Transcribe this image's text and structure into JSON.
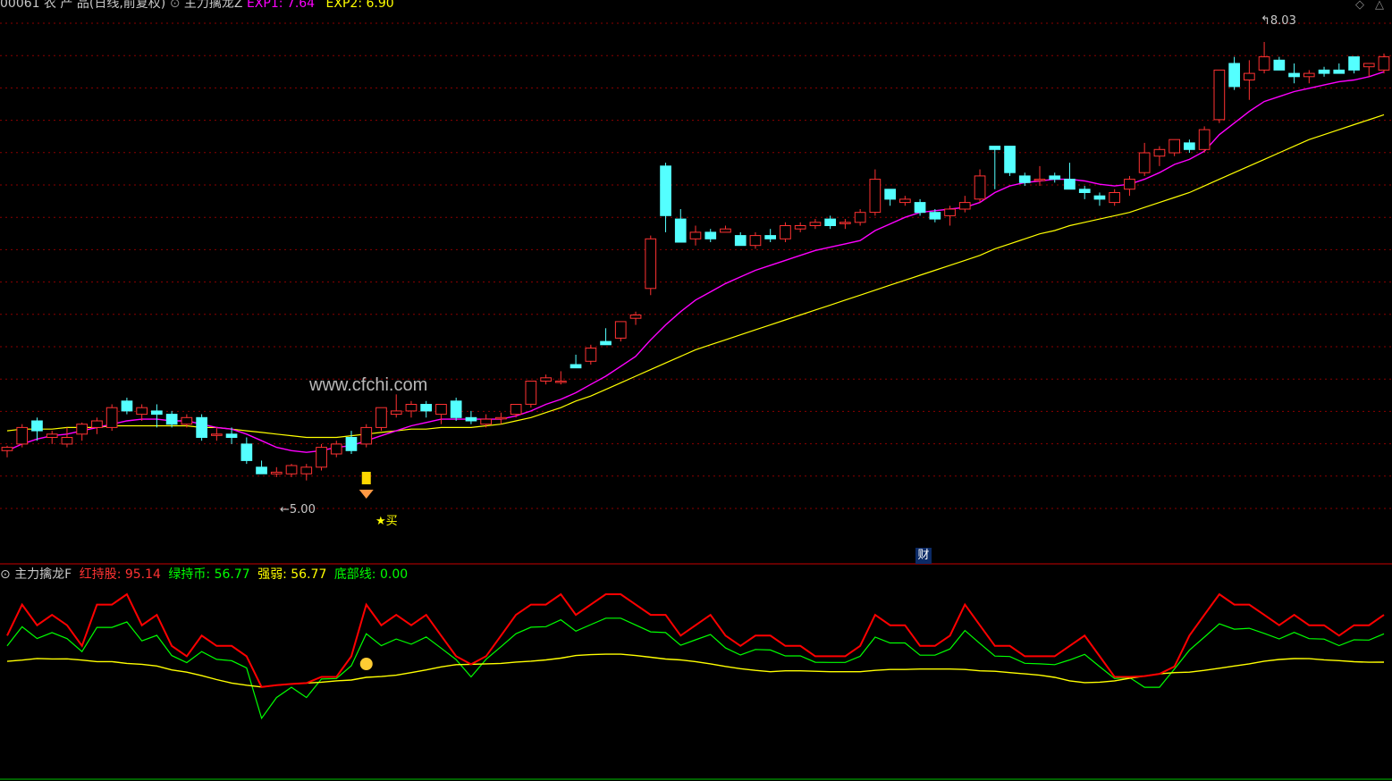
{
  "header": {
    "title": "00061 农 产 品(日线,前复权)",
    "indicator_name": "主力擒龙Z",
    "exp1_label": "EXP1: 7.64",
    "exp2_label": "EXP2: 6.90"
  },
  "main": {
    "high_label": "8.03",
    "low_label": "5.00",
    "buy_label": "★买",
    "watermark": "www.cfchi.com",
    "finance_badge": "财"
  },
  "lower": {
    "indicator_name": "主力擒龙F",
    "red_label": "红持股: 95.14",
    "green_label": "绿持币: 56.77",
    "strength_label": "强弱: 56.77",
    "bottom_label": "底部线: 0.00"
  },
  "colors": {
    "background": "#000000",
    "up": "#ff3232",
    "down": "#54ffff",
    "exp1": "#ff00ff",
    "exp2": "#ffff00",
    "red_line": "#ff0000",
    "green_line": "#00ff00",
    "grid": "#8b0000"
  },
  "chart_data": {
    "type": "candlestick",
    "candles": [
      [
        5.56,
        5.59,
        5.52,
        5.58
      ],
      [
        5.6,
        5.72,
        5.58,
        5.7
      ],
      [
        5.74,
        5.76,
        5.62,
        5.68
      ],
      [
        5.64,
        5.68,
        5.6,
        5.66
      ],
      [
        5.6,
        5.7,
        5.58,
        5.64
      ],
      [
        5.66,
        5.73,
        5.62,
        5.72
      ],
      [
        5.7,
        5.76,
        5.66,
        5.74
      ],
      [
        5.7,
        5.84,
        5.68,
        5.82
      ],
      [
        5.86,
        5.88,
        5.78,
        5.8
      ],
      [
        5.78,
        5.84,
        5.74,
        5.82
      ],
      [
        5.8,
        5.84,
        5.7,
        5.78
      ],
      [
        5.78,
        5.8,
        5.7,
        5.72
      ],
      [
        5.72,
        5.78,
        5.7,
        5.76
      ],
      [
        5.76,
        5.78,
        5.62,
        5.64
      ],
      [
        5.66,
        5.7,
        5.62,
        5.66
      ],
      [
        5.66,
        5.7,
        5.6,
        5.64
      ],
      [
        5.6,
        5.64,
        5.48,
        5.5
      ],
      [
        5.46,
        5.5,
        5.42,
        5.42
      ],
      [
        5.42,
        5.46,
        5.4,
        5.43
      ],
      [
        5.42,
        5.48,
        5.4,
        5.47
      ],
      [
        5.42,
        5.48,
        5.38,
        5.46
      ],
      [
        5.46,
        5.6,
        5.44,
        5.58
      ],
      [
        5.54,
        5.62,
        5.52,
        5.6
      ],
      [
        5.64,
        5.68,
        5.54,
        5.56
      ],
      [
        5.6,
        5.72,
        5.58,
        5.7
      ],
      [
        5.7,
        5.82,
        5.68,
        5.82
      ],
      [
        5.78,
        5.9,
        5.76,
        5.8
      ],
      [
        5.8,
        5.86,
        5.76,
        5.84
      ],
      [
        5.84,
        5.86,
        5.76,
        5.8
      ],
      [
        5.78,
        5.84,
        5.72,
        5.84
      ],
      [
        5.86,
        5.88,
        5.74,
        5.76
      ],
      [
        5.76,
        5.8,
        5.72,
        5.74
      ],
      [
        5.72,
        5.78,
        5.7,
        5.75
      ],
      [
        5.76,
        5.79,
        5.72,
        5.76
      ],
      [
        5.78,
        5.84,
        5.76,
        5.84
      ],
      [
        5.84,
        5.98,
        5.82,
        5.98
      ],
      [
        5.98,
        6.02,
        5.96,
        6.0
      ],
      [
        5.98,
        6.04,
        5.96,
        5.98
      ],
      [
        6.08,
        6.14,
        6.06,
        6.06
      ],
      [
        6.1,
        6.2,
        6.08,
        6.18
      ],
      [
        6.22,
        6.3,
        6.2,
        6.2
      ],
      [
        6.24,
        6.34,
        6.22,
        6.34
      ],
      [
        6.36,
        6.4,
        6.32,
        6.38
      ],
      [
        6.54,
        6.86,
        6.5,
        6.84
      ],
      [
        7.28,
        7.3,
        6.88,
        6.98
      ],
      [
        6.96,
        7.02,
        6.82,
        6.82
      ],
      [
        6.84,
        6.92,
        6.8,
        6.88
      ],
      [
        6.88,
        6.9,
        6.82,
        6.84
      ],
      [
        6.88,
        6.92,
        6.88,
        6.9
      ],
      [
        6.86,
        6.88,
        6.8,
        6.8
      ],
      [
        6.8,
        6.88,
        6.78,
        6.86
      ],
      [
        6.86,
        6.9,
        6.82,
        6.84
      ],
      [
        6.84,
        6.94,
        6.82,
        6.92
      ],
      [
        6.9,
        6.94,
        6.88,
        6.92
      ],
      [
        6.92,
        6.96,
        6.9,
        6.94
      ],
      [
        6.96,
        6.98,
        6.9,
        6.92
      ],
      [
        6.94,
        6.96,
        6.9,
        6.94
      ],
      [
        6.94,
        7.02,
        6.92,
        7.0
      ],
      [
        7.0,
        7.26,
        6.98,
        7.2
      ],
      [
        7.14,
        7.14,
        7.04,
        7.08
      ],
      [
        7.06,
        7.1,
        7.04,
        7.08
      ],
      [
        7.06,
        7.08,
        6.98,
        7.0
      ],
      [
        7.0,
        7.02,
        6.94,
        6.96
      ],
      [
        6.98,
        7.04,
        6.92,
        7.02
      ],
      [
        7.02,
        7.1,
        7.0,
        7.06
      ],
      [
        7.08,
        7.26,
        7.06,
        7.22
      ],
      [
        7.4,
        7.4,
        7.14,
        7.38
      ],
      [
        7.4,
        7.4,
        7.22,
        7.24
      ],
      [
        7.22,
        7.24,
        7.16,
        7.18
      ],
      [
        7.2,
        7.28,
        7.16,
        7.2
      ],
      [
        7.22,
        7.24,
        7.18,
        7.2
      ],
      [
        7.2,
        7.3,
        7.14,
        7.14
      ],
      [
        7.14,
        7.16,
        7.08,
        7.12
      ],
      [
        7.1,
        7.12,
        7.04,
        7.08
      ],
      [
        7.06,
        7.14,
        7.04,
        7.12
      ],
      [
        7.14,
        7.22,
        7.1,
        7.2
      ],
      [
        7.24,
        7.42,
        7.22,
        7.36
      ],
      [
        7.34,
        7.4,
        7.28,
        7.38
      ],
      [
        7.36,
        7.44,
        7.34,
        7.44
      ],
      [
        7.42,
        7.44,
        7.36,
        7.38
      ],
      [
        7.38,
        7.52,
        7.36,
        7.5
      ],
      [
        7.56,
        7.86,
        7.54,
        7.86
      ],
      [
        7.9,
        7.94,
        7.74,
        7.76
      ],
      [
        7.8,
        7.92,
        7.68,
        7.84
      ],
      [
        7.86,
        8.03,
        7.84,
        7.94
      ],
      [
        7.92,
        7.94,
        7.86,
        7.86
      ],
      [
        7.84,
        7.9,
        7.78,
        7.82
      ],
      [
        7.82,
        7.86,
        7.78,
        7.84
      ],
      [
        7.86,
        7.88,
        7.82,
        7.84
      ],
      [
        7.86,
        7.9,
        7.84,
        7.84
      ],
      [
        7.94,
        7.94,
        7.84,
        7.86
      ],
      [
        7.88,
        7.9,
        7.82,
        7.9
      ],
      [
        7.86,
        7.96,
        7.84,
        7.94
      ]
    ],
    "exp1": [
      5.56,
      5.6,
      5.63,
      5.65,
      5.66,
      5.68,
      5.7,
      5.72,
      5.74,
      5.75,
      5.75,
      5.74,
      5.74,
      5.72,
      5.7,
      5.69,
      5.66,
      5.62,
      5.58,
      5.56,
      5.55,
      5.56,
      5.58,
      5.59,
      5.62,
      5.65,
      5.68,
      5.71,
      5.73,
      5.75,
      5.75,
      5.75,
      5.75,
      5.75,
      5.77,
      5.8,
      5.84,
      5.87,
      5.91,
      5.96,
      6.01,
      6.07,
      6.13,
      6.23,
      6.32,
      6.4,
      6.47,
      6.52,
      6.57,
      6.61,
      6.65,
      6.68,
      6.71,
      6.74,
      6.77,
      6.79,
      6.81,
      6.83,
      6.89,
      6.93,
      6.97,
      7.0,
      7.01,
      7.02,
      7.03,
      7.06,
      7.12,
      7.16,
      7.18,
      7.19,
      7.2,
      7.2,
      7.19,
      7.17,
      7.16,
      7.17,
      7.2,
      7.24,
      7.29,
      7.32,
      7.37,
      7.47,
      7.54,
      7.61,
      7.67,
      7.7,
      7.73,
      7.75,
      7.77,
      7.79,
      7.8,
      7.82,
      7.85
    ],
    "exp2": [
      5.68,
      5.69,
      5.69,
      5.69,
      5.7,
      5.7,
      5.7,
      5.71,
      5.71,
      5.71,
      5.71,
      5.71,
      5.71,
      5.7,
      5.7,
      5.69,
      5.68,
      5.67,
      5.66,
      5.65,
      5.64,
      5.64,
      5.64,
      5.65,
      5.66,
      5.67,
      5.68,
      5.69,
      5.69,
      5.7,
      5.7,
      5.7,
      5.71,
      5.72,
      5.74,
      5.76,
      5.79,
      5.82,
      5.86,
      5.89,
      5.93,
      5.97,
      6.01,
      6.05,
      6.09,
      6.13,
      6.17,
      6.2,
      6.23,
      6.26,
      6.29,
      6.32,
      6.35,
      6.38,
      6.41,
      6.44,
      6.47,
      6.5,
      6.53,
      6.56,
      6.59,
      6.62,
      6.65,
      6.68,
      6.71,
      6.74,
      6.78,
      6.81,
      6.84,
      6.87,
      6.89,
      6.92,
      6.94,
      6.96,
      6.98,
      7.0,
      7.03,
      7.06,
      7.09,
      7.12,
      7.16,
      7.2,
      7.24,
      7.28,
      7.32,
      7.36,
      7.4,
      7.44,
      7.47,
      7.5,
      7.53,
      7.56,
      7.59
    ],
    "red_strength": [
      80,
      95,
      85,
      90,
      85,
      75,
      95,
      95,
      100,
      85,
      90,
      75,
      70,
      80,
      75,
      75,
      70,
      40,
      50,
      55,
      50,
      60,
      60,
      70,
      95,
      85,
      90,
      85,
      90,
      80,
      70,
      60,
      70,
      80,
      90,
      95,
      95,
      100,
      90,
      95,
      100,
      100,
      95,
      90,
      90,
      80,
      85,
      90,
      80,
      75,
      80,
      80,
      75,
      75,
      70,
      70,
      70,
      75,
      90,
      85,
      85,
      75,
      75,
      80,
      95,
      85,
      75,
      75,
      70,
      70,
      70,
      75,
      80,
      70,
      60,
      60,
      55,
      55,
      65,
      80,
      90,
      100,
      95,
      95,
      90,
      85,
      90,
      85,
      85,
      80,
      85,
      85,
      90
    ]
  }
}
